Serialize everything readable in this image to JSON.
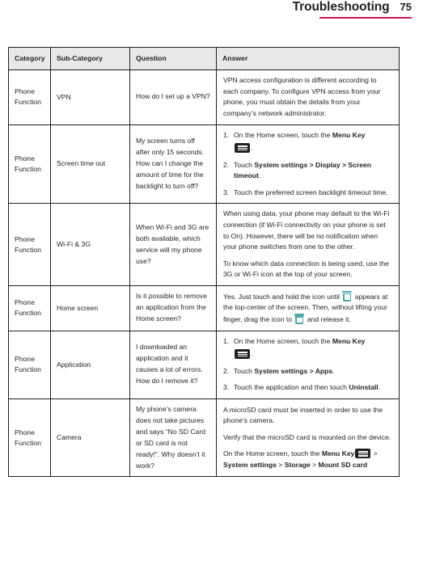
{
  "header": {
    "title": "Troubleshooting",
    "page_number": "75",
    "rule_color": "#c8154f"
  },
  "icons": {
    "menu_key": "menu-key-icon",
    "trash": "trash-icon",
    "trash_color": "#4aa8a8"
  },
  "table": {
    "columns": [
      "Category",
      "Sub-Category",
      "Question",
      "Answer"
    ],
    "header_bg": "#e8e8e8",
    "rows": [
      {
        "category": "Phone Function",
        "subcategory": "VPN",
        "question": "How do I set up a VPN?",
        "answer_paragraphs": [
          "VPN access configuration is different according to each company. To configure VPN access from your phone, you must obtain the details from your company’s network administrator."
        ]
      },
      {
        "category": "Phone Function",
        "subcategory": "Screen time out",
        "question": "My screen turns off after only 15 seconds. How can I change the amount of time for the backlight to turn off?",
        "steps": [
          {
            "num": "1.",
            "pre": "On the Home screen, touch the ",
            "bold": "Menu Key",
            "icon": "menu-key-icon",
            "post": "."
          },
          {
            "num": "2.",
            "pre": "Touch ",
            "bold": "System settings > Display > Screen timeout",
            "post": "."
          },
          {
            "num": "3.",
            "pre": "Touch the preferred screen backlight timeout time.",
            "post": ""
          }
        ]
      },
      {
        "category": "Phone Function",
        "subcategory": "Wi-Fi & 3G",
        "question": "When Wi-Fi and 3G are both available, which service will my phone use?",
        "answer_paragraphs": [
          "When using data, your phone may default to the Wi-Fi connection (if Wi-Fi connectivity on your phone is set to On). However, there will be no notification when your phone switches from one to the other.",
          "To know which data connection is being used, use the 3G or Wi-Fi icon at the top of your screen."
        ]
      },
      {
        "category": "Phone Function",
        "subcategory": "Home screen",
        "question": "Is it possible to remove an application from the Home screen?",
        "answer_inline": {
          "part1": "Yes. Just touch and hold the icon until ",
          "part2": " appears at the top-center of the screen. Then, without lifting your finger, drag the icon to ",
          "part3": " and release it."
        }
      },
      {
        "category": "Phone Function",
        "subcategory": "Application",
        "question": "I downloaded an application and it causes a lot of errors. How do I remove it?",
        "steps": [
          {
            "num": "1.",
            "pre": "On the Home screen, touch the ",
            "bold": "Menu Key",
            "icon": "menu-key-icon",
            "post": "."
          },
          {
            "num": "2.",
            "pre": "Touch ",
            "bold": "System settings > Apps",
            "post": "."
          },
          {
            "num": "3.",
            "pre": "Touch the application and then touch ",
            "bold": "Uninstall",
            "post": "."
          }
        ]
      },
      {
        "category": "Phone Function",
        "subcategory": "Camera",
        "question": "My phone’s camera does not take pictures and says “No SD Card or SD card is not ready!”. Why doesn’t it work?",
        "answer_paragraphs": [
          "A microSD card must be inserted in order to use the phone’s camera.",
          "Verify that the microSD card is mounted on the device."
        ],
        "answer_final": {
          "pre": "On the Home screen, touch the ",
          "bold1": "Menu Key",
          "mid": " > ",
          "bold2": "System settings",
          "mid2": " > ",
          "bold3": "Storage",
          "mid3": " > ",
          "bold4": "Mount SD card"
        }
      }
    ]
  }
}
